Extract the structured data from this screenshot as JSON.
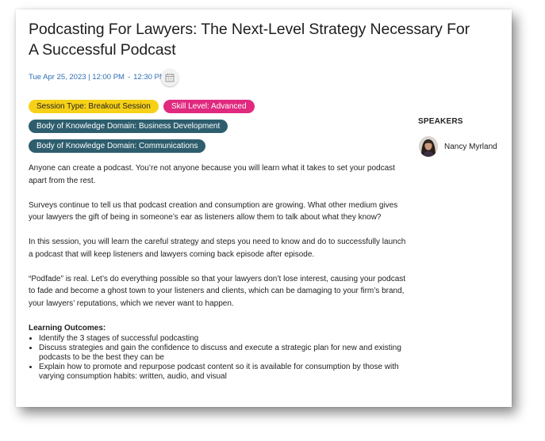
{
  "session": {
    "title": "Podcasting For Lawyers: The Next-Level Strategy Necessary For A Successful Podcast",
    "date": "Tue Apr 25, 2023 | 12:00 PM",
    "separator": "-",
    "end_time": "12:30 PM"
  },
  "tags": {
    "session_type": "Session Type: Breakout Session",
    "skill_level": "Skill Level: Advanced",
    "bok_1": "Body of Knowledge Domain: Business Development",
    "bok_2": "Body of Knowledge Domain: Communications"
  },
  "description": {
    "p1": "Anyone can create a podcast. You’re not anyone because you will learn what it takes to set your podcast apart from the rest.",
    "p2": "Surveys continue to tell us that podcast creation and consumption are growing. What other medium gives your lawyers the gift of being in someone’s ear as listeners allow them to talk about what they know?",
    "p3": "In this session, you will learn the careful strategy and steps you need to know and do to successfully launch a podcast that will keep listeners and lawyers coming back episode after episode.",
    "p4": "“Podfade” is real. Let’s do everything possible so that your lawyers don’t lose interest, causing your podcast to fade and become a ghost town to your listeners and clients, which can be damaging to your firm’s brand, your lawyers’ reputations, which we never want to happen."
  },
  "learning_outcomes": {
    "title": "Learning Outcomes:",
    "items": [
      "Identify the 3 stages of successful podcasting",
      "Discuss strategies and gain the confidence to discuss and execute a strategic plan for new and existing podcasts to be the best they can be",
      "Explain how to promote and repurpose podcast content so it is available for consumption by those with varying consumption habits: written, audio, and visual"
    ]
  },
  "speakers": {
    "title": "SPEAKERS",
    "list": [
      {
        "name": "Nancy Myrland",
        "icon": "avatar-photo"
      }
    ]
  },
  "icons": {
    "calendar": "calendar-icon"
  },
  "colors": {
    "date_link": "#2f6eb5",
    "session_tag": "#f7d117",
    "skill_tag": "#e0297f",
    "bok_tag": "#2e5e6e"
  }
}
